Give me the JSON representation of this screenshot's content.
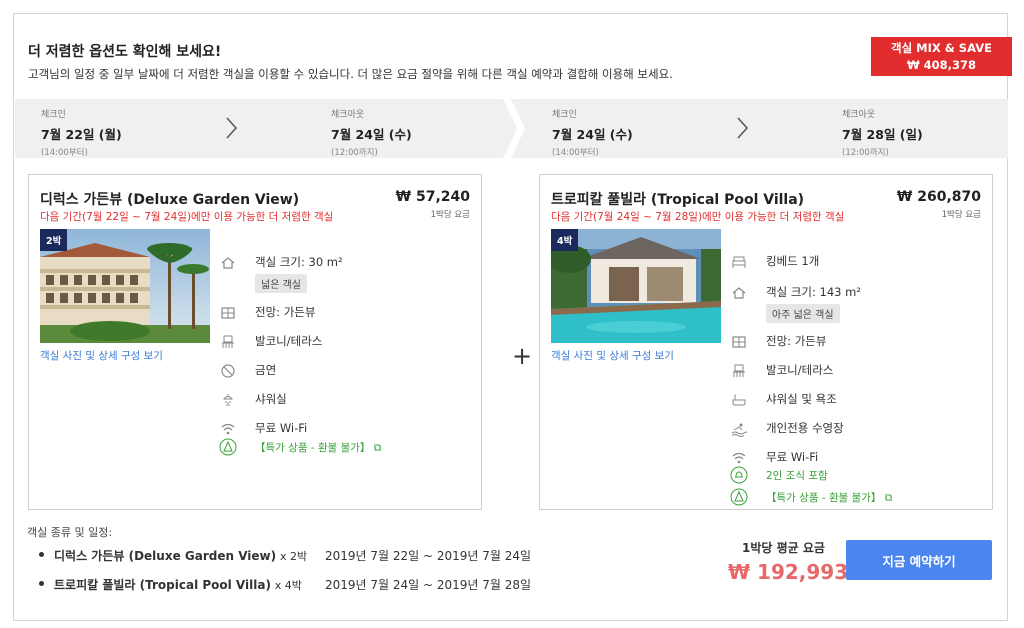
{
  "header": {
    "title": "더 저렴한 옵션도 확인해 보세요!",
    "subtitle": "고객님의 일정 중 일부 날짜에 더 저렴한 객실을 이용할 수 있습니다. 더 많은 요금 절약을 위해 다른 객실 예약과 결합해 이용해 보세요.",
    "mix_label": "객실 MIX & SAVE",
    "mix_price": "₩ 408,378"
  },
  "dates": [
    {
      "label": "체크인",
      "date": "7월 22일 (월)",
      "time": "(14:00부터)"
    },
    {
      "label": "체크아웃",
      "date": "7월 24일 (수)",
      "time": "(12:00까지)"
    },
    {
      "label": "체크인",
      "date": "7월 24일 (수)",
      "time": "(14:00부터)"
    },
    {
      "label": "체크아웃",
      "date": "7월 28일 (일)",
      "time": "(12:00까지)"
    }
  ],
  "rooms": [
    {
      "name": "디럭스 가든뷰 (Deluxe Garden View)",
      "price": "₩ 57,240",
      "per_night": "1박당 요금",
      "availability": "다음 기간(7월 22일 ~ 7월 24일)에만 이용 가능한 더 저렴한 객실",
      "nights": "2박",
      "detail_link": "객실 사진 및 상세 구성 보기",
      "features": {
        "size": "객실 크기: 30 m²",
        "size_tag": "넓은 객실",
        "view": "전망: 가든뷰",
        "balcony": "발코니/테라스",
        "nosmoking": "금연",
        "shower": "샤워실",
        "wifi": "무료 Wi-Fi",
        "promo": "【특가 상품 - 환불 불가】"
      }
    },
    {
      "name": "트로피칼 풀빌라 (Tropical Pool Villa)",
      "price": "₩ 260,870",
      "per_night": "1박당 요금",
      "availability": "다음 기간(7월 24일 ~ 7월 28일)에만 이용 가능한 더 저렴한 객실",
      "nights": "4박",
      "detail_link": "객실 사진 및 상세 구성 보기",
      "features": {
        "bed": "킹베드 1개",
        "size": "객실 크기: 143 m²",
        "size_tag": "아주 넓은 객실",
        "view": "전망: 가든뷰",
        "balcony": "발코니/테라스",
        "bath": "샤워실 및 욕조",
        "pool": "개인전용 수영장",
        "wifi": "무료 Wi-Fi",
        "breakfast": "2인 조식 포함",
        "promo": "【특가 상품 - 환불 불가】"
      }
    }
  ],
  "plus_sign": "+",
  "summary": {
    "title": "객실 종류 및 일정:",
    "items": [
      {
        "name": "디럭스 가든뷰 (Deluxe Garden View)",
        "nights": "x 2박",
        "dates": "2019년 7월 22일 ~ 2019년 7월 24일"
      },
      {
        "name": "트로피칼 풀빌라 (Tropical Pool Villa)",
        "nights": "x 4박",
        "dates": "2019년 7월 24일 ~ 2019년 7월 28일"
      }
    ],
    "avg_label": "1박당 평균 요금",
    "avg_price": "₩ 192,993",
    "book_label": "지금 예약하기"
  },
  "colors": {
    "accent_red": "#e12d2d",
    "book_blue": "#4b86ee",
    "navy_badge": "#1b2a5c",
    "green_text": "#3aa13a"
  }
}
